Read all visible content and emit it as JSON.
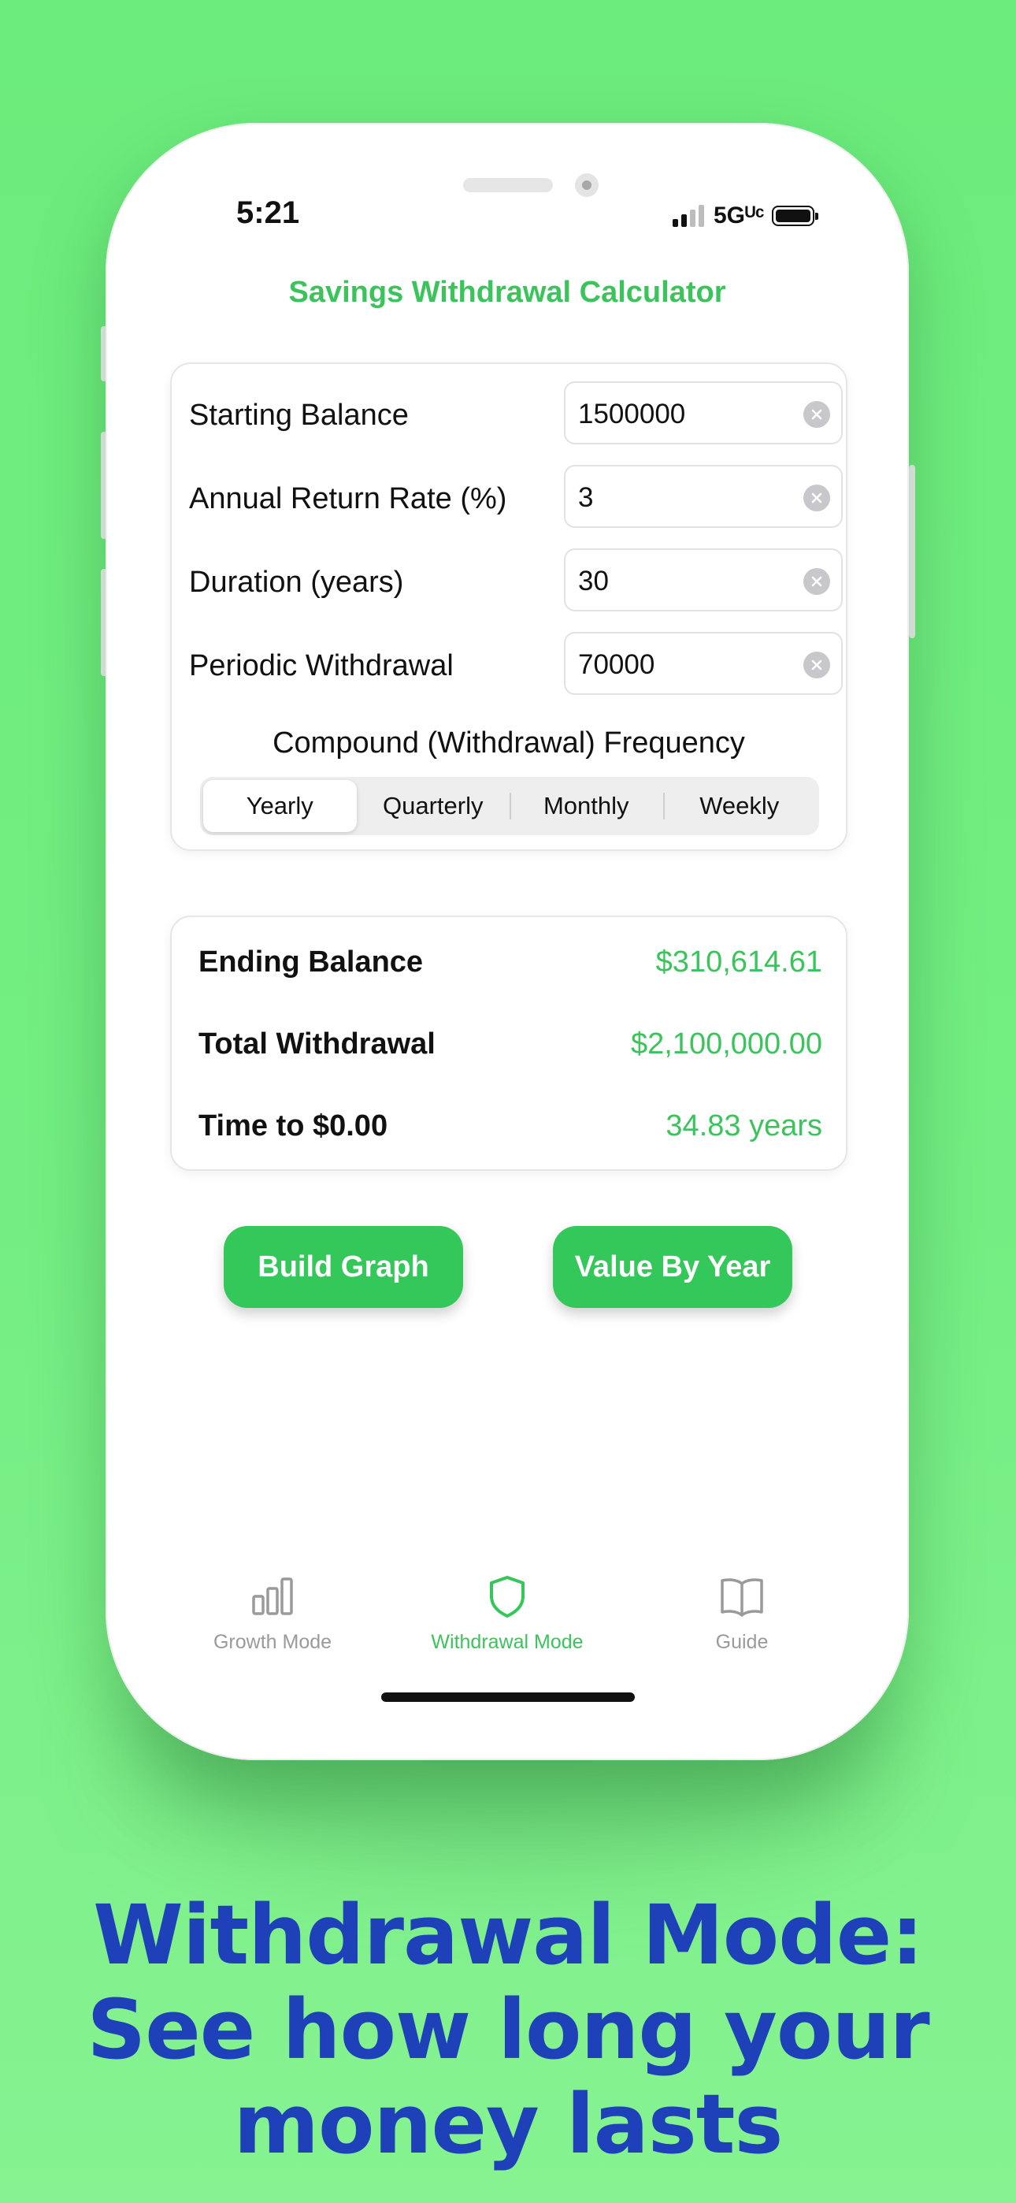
{
  "status_bar": {
    "time": "5:21",
    "network": "5Gᵁᶜ"
  },
  "app": {
    "title": "Savings Withdrawal Calculator"
  },
  "inputs": [
    {
      "label": "Starting Balance",
      "value": "1500000"
    },
    {
      "label": "Annual Return Rate (%)",
      "value": "3"
    },
    {
      "label": "Duration (years)",
      "value": "30"
    },
    {
      "label": "Periodic Withdrawal",
      "value": "70000"
    }
  ],
  "frequency": {
    "label": "Compound (Withdrawal) Frequency",
    "options": [
      "Yearly",
      "Quarterly",
      "Monthly",
      "Weekly"
    ],
    "selected": "Yearly"
  },
  "results": [
    {
      "label": "Ending Balance",
      "value": "$310,614.61"
    },
    {
      "label": "Total Withdrawal",
      "value": "$2,100,000.00"
    },
    {
      "label": "Time to $0.00",
      "value": "34.83 years"
    }
  ],
  "actions": {
    "build_graph": "Build Graph",
    "value_by_year": "Value By Year"
  },
  "tabs": [
    {
      "label": "Growth Mode",
      "icon": "bar-chart-icon",
      "active": false
    },
    {
      "label": "Withdrawal Mode",
      "icon": "shield-icon",
      "active": true
    },
    {
      "label": "Guide",
      "icon": "book-icon",
      "active": false
    }
  ],
  "headline": {
    "line1": "Withdrawal Mode:",
    "line2": "See how long your",
    "line3": "money lasts"
  },
  "colors": {
    "accent": "#34c759",
    "headline": "#1e40b8",
    "background": "#6cec7c"
  }
}
